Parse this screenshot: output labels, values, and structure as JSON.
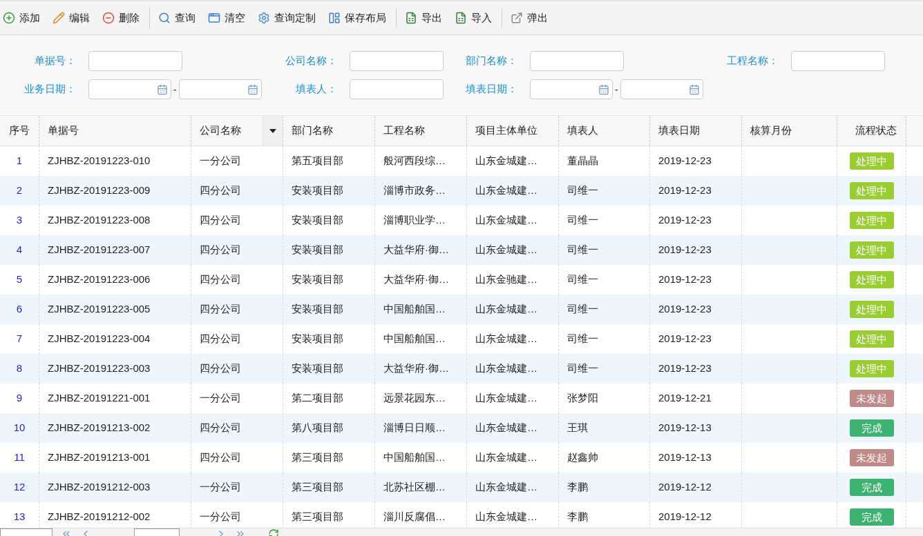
{
  "toolbar": {
    "groups": [
      [
        "添加",
        "编辑",
        "删除"
      ],
      [
        "查询",
        "清空",
        "查询定制",
        "保存布局"
      ],
      [
        "导出",
        "导入"
      ],
      [
        "弹出"
      ]
    ]
  },
  "filters": {
    "row_1": [
      {
        "label": "单据号：",
        "kind": "text"
      },
      {
        "label": "公司名称：",
        "kind": "text"
      },
      {
        "label": "部门名称：",
        "kind": "text"
      },
      {
        "label": "工程名称：",
        "kind": "text"
      }
    ],
    "row_2": [
      {
        "label": "业务日期：",
        "kind": "date_range",
        "separator": "-"
      },
      {
        "label": "填表人：",
        "kind": "text"
      },
      {
        "label": "填表日期：",
        "kind": "date_range",
        "separator": "-"
      }
    ]
  },
  "table": {
    "columns": [
      "序号",
      "单据号",
      "公司名称",
      "部门名称",
      "工程名称",
      "项目主体单位",
      "填表人",
      "填表日期",
      "核算月份",
      "流程状态"
    ],
    "rows": [
      {
        "cells": [
          "1",
          "ZJHBZ-20191223-010",
          "一分公司",
          "第五项目部",
          "般河西段综…",
          "山东金城建…",
          "董晶晶",
          "2019-12-23",
          ""
        ],
        "status": {
          "label": "处理中",
          "color": "#9acd32"
        }
      },
      {
        "cells": [
          "2",
          "ZJHBZ-20191223-009",
          "四分公司",
          "安装项目部",
          "淄博市政务…",
          "山东金城建…",
          "司维一",
          "2019-12-23",
          ""
        ],
        "status": {
          "label": "处理中",
          "color": "#9acd32"
        }
      },
      {
        "cells": [
          "3",
          "ZJHBZ-20191223-008",
          "四分公司",
          "安装项目部",
          "淄博职业学…",
          "山东金城建…",
          "司维一",
          "2019-12-23",
          ""
        ],
        "status": {
          "label": "处理中",
          "color": "#9acd32"
        }
      },
      {
        "cells": [
          "4",
          "ZJHBZ-20191223-007",
          "四分公司",
          "安装项目部",
          "大益华府·御…",
          "山东金城建…",
          "司维一",
          "2019-12-23",
          ""
        ],
        "status": {
          "label": "处理中",
          "color": "#9acd32"
        }
      },
      {
        "cells": [
          "5",
          "ZJHBZ-20191223-006",
          "四分公司",
          "安装项目部",
          "大益华府·御…",
          "山东金驰建…",
          "司维一",
          "2019-12-23",
          ""
        ],
        "status": {
          "label": "处理中",
          "color": "#9acd32"
        }
      },
      {
        "cells": [
          "6",
          "ZJHBZ-20191223-005",
          "四分公司",
          "安装项目部",
          "中国船舶国…",
          "山东金城建…",
          "司维一",
          "2019-12-23",
          ""
        ],
        "status": {
          "label": "处理中",
          "color": "#9acd32"
        }
      },
      {
        "cells": [
          "7",
          "ZJHBZ-20191223-004",
          "四分公司",
          "安装项目部",
          "中国船舶国…",
          "山东金城建…",
          "司维一",
          "2019-12-23",
          ""
        ],
        "status": {
          "label": "处理中",
          "color": "#9acd32"
        }
      },
      {
        "cells": [
          "8",
          "ZJHBZ-20191223-003",
          "四分公司",
          "安装项目部",
          "大益华府·御…",
          "山东金城建…",
          "司维一",
          "2019-12-23",
          ""
        ],
        "status": {
          "label": "处理中",
          "color": "#9acd32"
        }
      },
      {
        "cells": [
          "9",
          "ZJHBZ-20191221-001",
          "一分公司",
          "第二项目部",
          "远景花园东…",
          "山东金城建…",
          "张梦阳",
          "2019-12-21",
          ""
        ],
        "status": {
          "label": "未发起",
          "color": "#c08a88"
        }
      },
      {
        "cells": [
          "10",
          "ZJHBZ-20191213-002",
          "四分公司",
          "第八项目部",
          "淄博日日顺…",
          "山东金城建…",
          "王琪",
          "2019-12-13",
          ""
        ],
        "status": {
          "label": "完成",
          "color": "#3cb371"
        }
      },
      {
        "cells": [
          "11",
          "ZJHBZ-20191213-001",
          "四分公司",
          "第三项目部",
          "中国船舶国…",
          "山东金城建…",
          "赵鑫帅",
          "2019-12-13",
          ""
        ],
        "status": {
          "label": "未发起",
          "color": "#c08a88"
        }
      },
      {
        "cells": [
          "12",
          "ZJHBZ-20191212-003",
          "一分公司",
          "第三项目部",
          "北苏社区棚…",
          "山东金城建…",
          "李鹏",
          "2019-12-12",
          ""
        ],
        "status": {
          "label": "完成",
          "color": "#3cb371"
        }
      },
      {
        "cells": [
          "13",
          "ZJHBZ-20191212-002",
          "一分公司",
          "第三项目部",
          "淄川反腐倡…",
          "山东金城建…",
          "李鹏",
          "2019-12-12",
          ""
        ],
        "status": {
          "label": "完成",
          "color": "#3cb371"
        }
      }
    ]
  }
}
